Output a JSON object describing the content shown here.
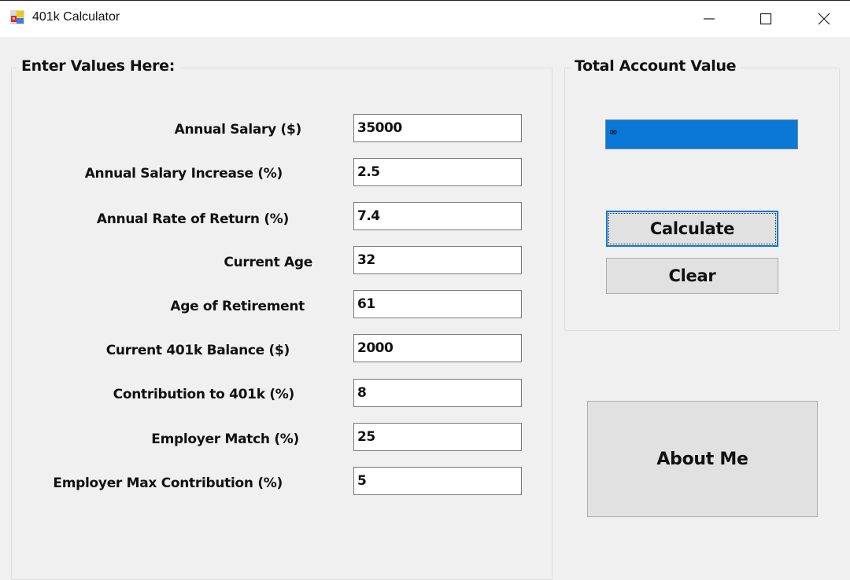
{
  "window": {
    "title": "401k Calculator",
    "controls": {
      "minimize": "minimize",
      "maximize": "maximize",
      "close": "close"
    }
  },
  "inputs_group": {
    "title": "Enter Values Here:",
    "fields": [
      {
        "label": "Annual Salary ($)",
        "value": "35000"
      },
      {
        "label": "Annual Salary Increase (%)",
        "value": "2.5"
      },
      {
        "label": "Annual Rate of Return (%)",
        "value": "7.4"
      },
      {
        "label": "Current Age",
        "value": "32"
      },
      {
        "label": "Age of Retirement",
        "value": "61"
      },
      {
        "label": "Current 401k Balance ($)",
        "value": "2000"
      },
      {
        "label": "Contribution to 401k (%)",
        "value": "8"
      },
      {
        "label": "Employer Match (%)",
        "value": "25"
      },
      {
        "label": "Employer Max Contribution (%)",
        "value": "5"
      }
    ]
  },
  "result_group": {
    "title": "Total Account Value",
    "value": "∞",
    "highlight_color": "#0a78d7"
  },
  "buttons": {
    "calculate": "Calculate",
    "clear": "Clear",
    "about": "About Me"
  }
}
